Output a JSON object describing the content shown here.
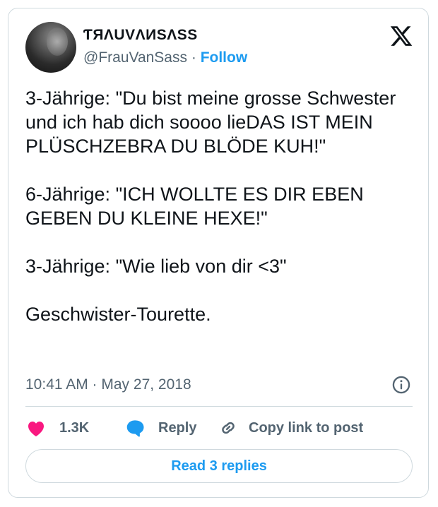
{
  "author": {
    "display_name": "ƬЯΛUVΛИSΛSS",
    "handle": "@FrauVanSass",
    "separator": "·",
    "follow_label": "Follow"
  },
  "tweet": {
    "text": "3-Jährige: \"Du bist meine grosse Schwester und ich hab dich soooo lieDAS IST MEIN PLÜSCHZEBRA DU BLÖDE KUH!\"\n\n6-Jährige: \"ICH WOLLTE ES DIR EBEN GEBEN DU KLEINE HEXE!\"\n\n3-Jährige: \"Wie lieb von dir <3\"\n\nGeschwister-Tourette.",
    "timestamp": "10:41 AM · May 27, 2018"
  },
  "actions": {
    "likes_count": "1.3K",
    "reply_label": "Reply",
    "copy_link_label": "Copy link to post"
  },
  "footer": {
    "read_replies_label": "Read 3 replies"
  },
  "colors": {
    "accent": "#1d9bf0",
    "like": "#f91880",
    "muted_text": "#536471",
    "border": "#cfd9de"
  },
  "icons": [
    "x-logo-icon",
    "info-icon",
    "heart-icon",
    "reply-bubble-icon",
    "link-icon"
  ]
}
